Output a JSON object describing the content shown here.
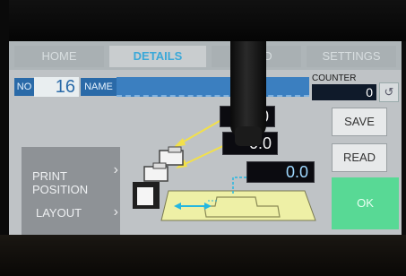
{
  "tabs": [
    {
      "label": "HOME"
    },
    {
      "label": "DETAILS"
    },
    {
      "label": "LOAD"
    },
    {
      "label": "SETTINGS"
    }
  ],
  "program": {
    "no_label": "NO",
    "no_value": "16",
    "name_label": "NAME",
    "name_value": ""
  },
  "counter": {
    "label": "COUNTER",
    "value": "0"
  },
  "readouts": {
    "top": "0.0",
    "middle": "0.0",
    "position": "0.0"
  },
  "menu": {
    "print_position": "PRINT\nPOSITION",
    "layout": "LAYOUT"
  },
  "buttons": {
    "save": "SAVE",
    "read": "READ",
    "ok": "OK"
  },
  "colors": {
    "accent": "#3aa8d8",
    "ok": "#58d995",
    "name_field": "#3b7fc0",
    "plate": "#eef0a6",
    "arrow_yellow": "#f2e04a",
    "arrow_cyan": "#25b7e0"
  }
}
